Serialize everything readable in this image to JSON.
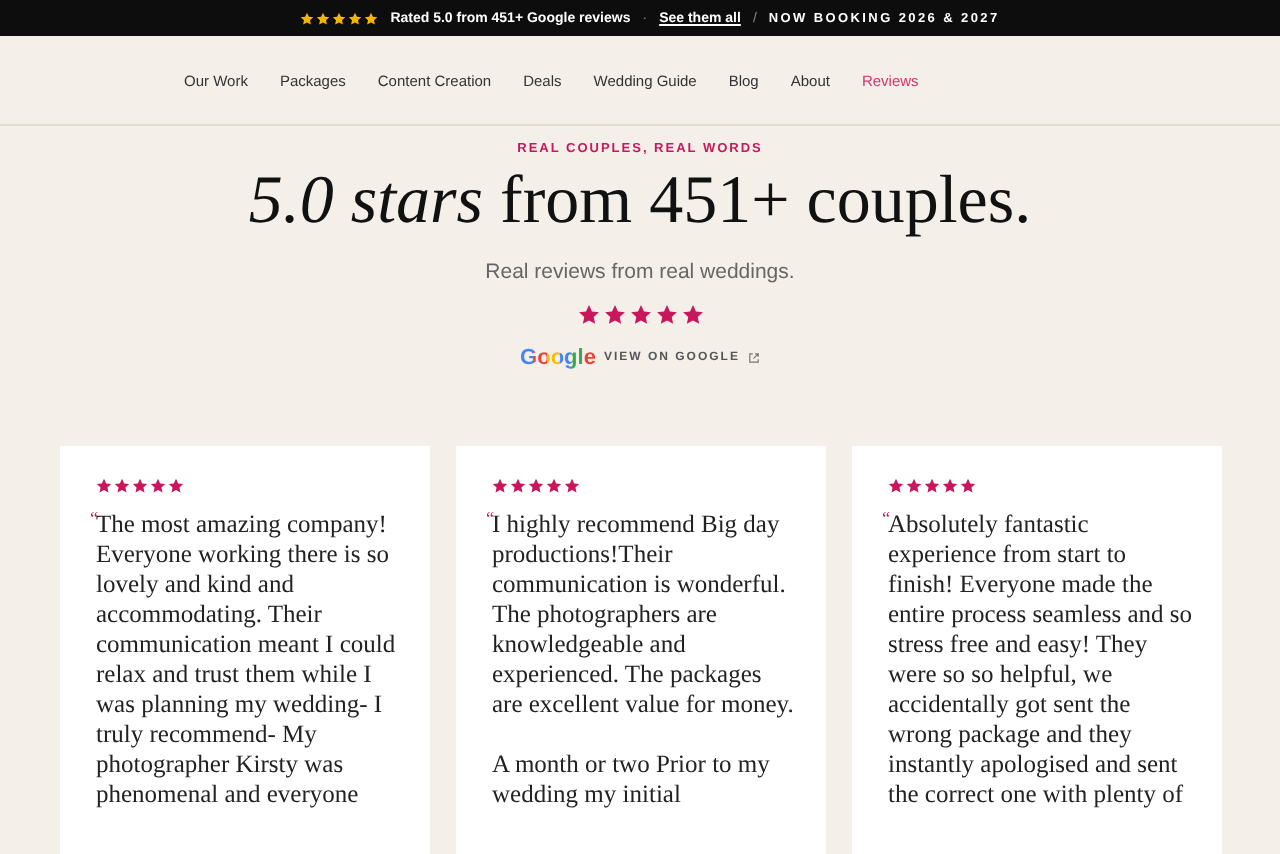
{
  "announcement": {
    "stars": 5,
    "rating_text": "Rated 5.0 from 451+ Google reviews",
    "separator": "·",
    "link": "See them all",
    "divider": "/",
    "booking": "NOW BOOKING 2026 & 2027"
  },
  "nav": {
    "items": [
      {
        "label": "Our Work",
        "selected": false
      },
      {
        "label": "Packages",
        "selected": false
      },
      {
        "label": "Content Creation",
        "selected": false
      },
      {
        "label": "Deals",
        "selected": false
      },
      {
        "label": "Wedding Guide",
        "selected": false
      },
      {
        "label": "Blog",
        "selected": false
      },
      {
        "label": "About",
        "selected": false
      },
      {
        "label": "Reviews",
        "selected": true
      }
    ]
  },
  "hero": {
    "eyebrow": "REAL COUPLES, REAL WORDS",
    "title": "*5.0 stars* from 451+ couples.",
    "subtitle": "Real reviews from real weddings.",
    "stars": 5,
    "google_logo": "Google",
    "google_link": "VIEW ON GOOGLE"
  },
  "reviews": [
    {
      "stars": 5,
      "quote_mark": "“",
      "paragraphs": [
        "The most amazing company! Everyone working there is so lovely and kind and accommodating. Their communication meant I could relax and trust them while I was planning my wedding- I truly recommend- My photographer Kirsty was phenomenal and everyone"
      ]
    },
    {
      "stars": 5,
      "quote_mark": "“",
      "paragraphs": [
        "I highly recommend Big day productions!Their communication is wonderful. The photographers are knowledgeable and experienced. The packages are excellent value for money.",
        "A month or two Prior to my wedding my initial"
      ]
    },
    {
      "stars": 5,
      "quote_mark": "“",
      "paragraphs": [
        "Absolutely fantastic experience from start to finish! Everyone made the entire process seamless and so stress free and easy! They were so so helpful, we accidentally got sent the wrong package and they instantly apologised and sent the correct one with plenty of"
      ]
    }
  ]
}
